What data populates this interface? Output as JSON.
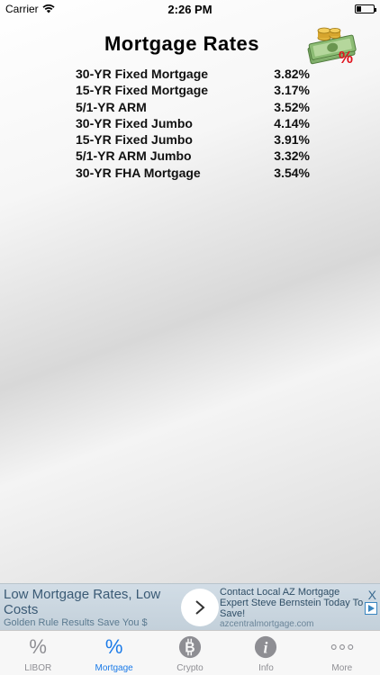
{
  "status": {
    "carrier": "Carrier",
    "time": "2:26 PM"
  },
  "title": "Mortgage Rates",
  "rates": [
    {
      "label": "30-YR Fixed Mortgage",
      "value": "3.82%"
    },
    {
      "label": "15-YR Fixed Mortgage",
      "value": "3.17%"
    },
    {
      "label": "5/1-YR ARM",
      "value": "3.52%"
    },
    {
      "label": "30-YR Fixed Jumbo",
      "value": "4.14%"
    },
    {
      "label": "15-YR Fixed Jumbo",
      "value": "3.91%"
    },
    {
      "label": "5/1-YR ARM Jumbo",
      "value": "3.32%"
    },
    {
      "label": "30-YR FHA Mortgage",
      "value": "3.54%"
    }
  ],
  "ad": {
    "left_title": "Low Mortgage Rates, Low Costs",
    "left_sub": "Golden Rule Results Save You $",
    "right_text": "Contact Local AZ Mortgage Expert Steve Bernstein Today To Save!",
    "right_url": "azcentralmortgage.com",
    "close": "X"
  },
  "tabs": [
    {
      "label": "LIBOR",
      "icon": "percent-icon",
      "active": false
    },
    {
      "label": "Mortgage",
      "icon": "percent-icon",
      "active": true
    },
    {
      "label": "Crypto",
      "icon": "bitcoin-icon",
      "active": false
    },
    {
      "label": "Info",
      "icon": "info-icon",
      "active": false
    },
    {
      "label": "More",
      "icon": "more-icon",
      "active": false
    }
  ],
  "colors": {
    "active_tab": "#1a7ae8",
    "inactive_tab": "#8e8e93",
    "ad_bg": "#c3d0da"
  }
}
